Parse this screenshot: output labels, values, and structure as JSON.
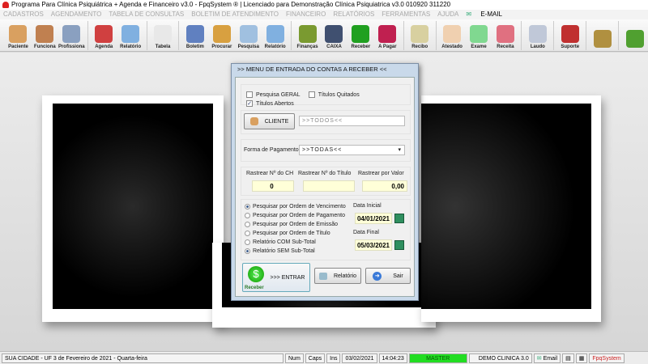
{
  "window": {
    "title": "Programa Para Clínica Psiquiátrica + Agenda e Financeiro v3.0 - FpqSystem ® | Licenciado para  Demonstração Clínica Psiquiatrica v3.0 010920 311220"
  },
  "menu": [
    "CADASTROS",
    "AGENDAMENTO",
    "TABELA DE CONSULTAS",
    "BOLETIM DE ATENDIMENTO",
    "FINANCEIRO",
    "RELATÓRIOS",
    "FERRAMENTAS",
    "AJUDA"
  ],
  "menu_email": "E-MAIL",
  "toolbar": [
    {
      "label": "Paciente",
      "color": "#d9a060"
    },
    {
      "label": "Funciona",
      "color": "#c08050"
    },
    {
      "label": "Profissiona",
      "color": "#8aa0c0"
    },
    "sep",
    {
      "label": "Agenda",
      "color": "#d04040"
    },
    {
      "label": "Relatório",
      "color": "#80b0e0"
    },
    "sep",
    {
      "label": "Tabela",
      "color": "#e8e8e8"
    },
    "sep",
    {
      "label": "Boletim",
      "color": "#6080c0"
    },
    {
      "label": "Procurar",
      "color": "#d8a040"
    },
    {
      "label": "Pesquisa",
      "color": "#a0c0e0"
    },
    {
      "label": "Relatório",
      "color": "#80b0e0"
    },
    "sep",
    {
      "label": "Finanças",
      "color": "#7a9a30"
    },
    {
      "label": "CAIXA",
      "color": "#405070"
    },
    {
      "label": "Receber",
      "color": "#20a020"
    },
    {
      "label": "A Pagar",
      "color": "#c02050"
    },
    "sep",
    {
      "label": "Recibo",
      "color": "#d8d0a0"
    },
    "sep",
    {
      "label": "Atestado",
      "color": "#f0d0b0"
    },
    {
      "label": "Exame",
      "color": "#80d890"
    },
    {
      "label": "Receita",
      "color": "#e07080"
    },
    "sep",
    {
      "label": "Laudo",
      "color": "#c0c8d8"
    },
    "sep",
    {
      "label": "Suporte",
      "color": "#c03030"
    },
    "sep",
    {
      "label": "",
      "color": "#b09040"
    },
    "sep",
    {
      "label": "",
      "color": "#50a030"
    }
  ],
  "dialog": {
    "title": ">>  MENU DE ENTRADA DO CONTAS A RECEBER  <<",
    "checkboxes": [
      {
        "label": "Pesquisa GERAL",
        "checked": false
      },
      {
        "label": "Títulos Quitados",
        "checked": false
      },
      {
        "label": "Títulos Abertos",
        "checked": true
      }
    ],
    "cliente_button": "CLIENTE",
    "cliente_value": ">>TODOS<<",
    "forma_label": "Forma de Pagamento",
    "forma_value": ">>TODAS<<",
    "rastrear": [
      {
        "label": "Rastrear Nº do CH",
        "value": "0"
      },
      {
        "label": "Rastrear Nº do Título",
        "value": ""
      },
      {
        "label": "Rastrear por Valor",
        "value": "0,00"
      }
    ],
    "radios": [
      {
        "label": "Pesquisar por Ordem de Vencimento",
        "checked": true
      },
      {
        "label": "Pesquisar por Ordem de Pagamento",
        "checked": false
      },
      {
        "label": "Pesquisar por Ordem de Emissão",
        "checked": false
      },
      {
        "label": "Pesquisar por Ordem de Título",
        "checked": false
      },
      {
        "label": "Relatório COM Sub-Total",
        "checked": false
      },
      {
        "label": "Relatório SEM Sub-Total",
        "checked": true
      }
    ],
    "data_inicial_label": "Data Inicial",
    "data_inicial": "04/01/2021",
    "data_final_label": "Data Final",
    "data_final": "05/03/2021",
    "entrar": ">>> ENTRAR",
    "entrar_icon_label": "Receber",
    "relatorio": "Relatório",
    "sair": "Sair"
  },
  "status": {
    "city": "SUA CIDADE - UF  3 de Fevereiro de 2021 - Quarta-feira",
    "num": "Num",
    "caps": "Caps",
    "ins": "Ins",
    "date": "03/02/2021",
    "time": "14:04:23",
    "user": "MASTER",
    "user_color": "#22dd22",
    "db": "DEMO CLINICA 3.0",
    "email": "Email",
    "brand": "FpqSystem",
    "brand_color": "#cc2222"
  }
}
